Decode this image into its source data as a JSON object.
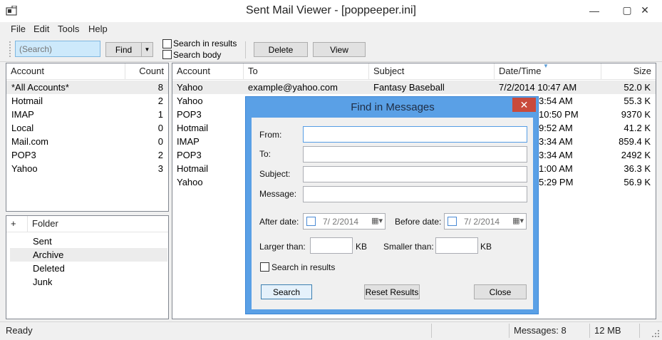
{
  "window": {
    "title": "Sent Mail Viewer - [poppeeper.ini]",
    "minimize_glyph": "—",
    "maximize_glyph": "▢",
    "close_glyph": "✕"
  },
  "menu": [
    "File",
    "Edit",
    "Tools",
    "Help"
  ],
  "toolbar": {
    "search_placeholder": "(Search)",
    "find_label": "Find",
    "dropdown_glyph": "▼",
    "search_in_results_label": "Search in results",
    "search_body_label": "Search body",
    "delete_label": "Delete",
    "view_label": "View"
  },
  "accounts": {
    "headers": {
      "account": "Account",
      "count": "Count"
    },
    "rows": [
      {
        "name": "*All Accounts*",
        "count": "8"
      },
      {
        "name": "Hotmail",
        "count": "2"
      },
      {
        "name": "IMAP",
        "count": "1"
      },
      {
        "name": "Local",
        "count": "0"
      },
      {
        "name": "Mail.com",
        "count": "0"
      },
      {
        "name": "POP3",
        "count": "2"
      },
      {
        "name": "Yahoo",
        "count": "3"
      }
    ]
  },
  "folders": {
    "headers": {
      "expand": "+",
      "folder": "Folder"
    },
    "rows": [
      "Sent",
      "Archive",
      "Deleted",
      "Junk"
    ]
  },
  "messages": {
    "headers": {
      "account": "Account",
      "to": "To",
      "subject": "Subject",
      "date": "Date/Time",
      "size": "Size"
    },
    "rows": [
      {
        "account": "Yahoo",
        "to": "example@yahoo.com",
        "subject": "Fantasy Baseball",
        "date": "7/2/2014 10:47 AM",
        "size": "52.0 K"
      },
      {
        "account": "Yahoo",
        "to": "",
        "subject": "",
        "date": "3:54 AM",
        "size": "55.3 K"
      },
      {
        "account": "POP3",
        "to": "",
        "subject": "",
        "date": "10:50 PM",
        "size": "9370 K"
      },
      {
        "account": "Hotmail",
        "to": "",
        "subject": "",
        "date": "9:52 AM",
        "size": "41.2 K"
      },
      {
        "account": "IMAP",
        "to": "",
        "subject": "",
        "date": "3:34 AM",
        "size": "859.4 K"
      },
      {
        "account": "POP3",
        "to": "",
        "subject": "",
        "date": "3:34 AM",
        "size": "2492 K"
      },
      {
        "account": "Hotmail",
        "to": "",
        "subject": "",
        "date": "1:00 AM",
        "size": "36.3 K"
      },
      {
        "account": "Yahoo",
        "to": "",
        "subject": "",
        "date": "5:29 PM",
        "size": "56.9 K"
      }
    ]
  },
  "status": {
    "state": "Ready",
    "messages": "Messages: 8",
    "size": "12 MB"
  },
  "dialog": {
    "title": "Find in Messages",
    "close_glyph": "✕",
    "from_label": "From:",
    "to_label": "To:",
    "subject_label": "Subject:",
    "message_label": "Message:",
    "after_date_label": "After date:",
    "after_date_value": "7/  2/2014",
    "before_date_label": "Before date:",
    "before_date_value": "7/  2/2014",
    "larger_than_label": "Larger than:",
    "smaller_than_label": "Smaller than:",
    "kb_unit": "KB",
    "search_in_results_label": "Search in results",
    "search_button": "Search",
    "reset_button": "Reset Results",
    "close_button": "Close"
  }
}
